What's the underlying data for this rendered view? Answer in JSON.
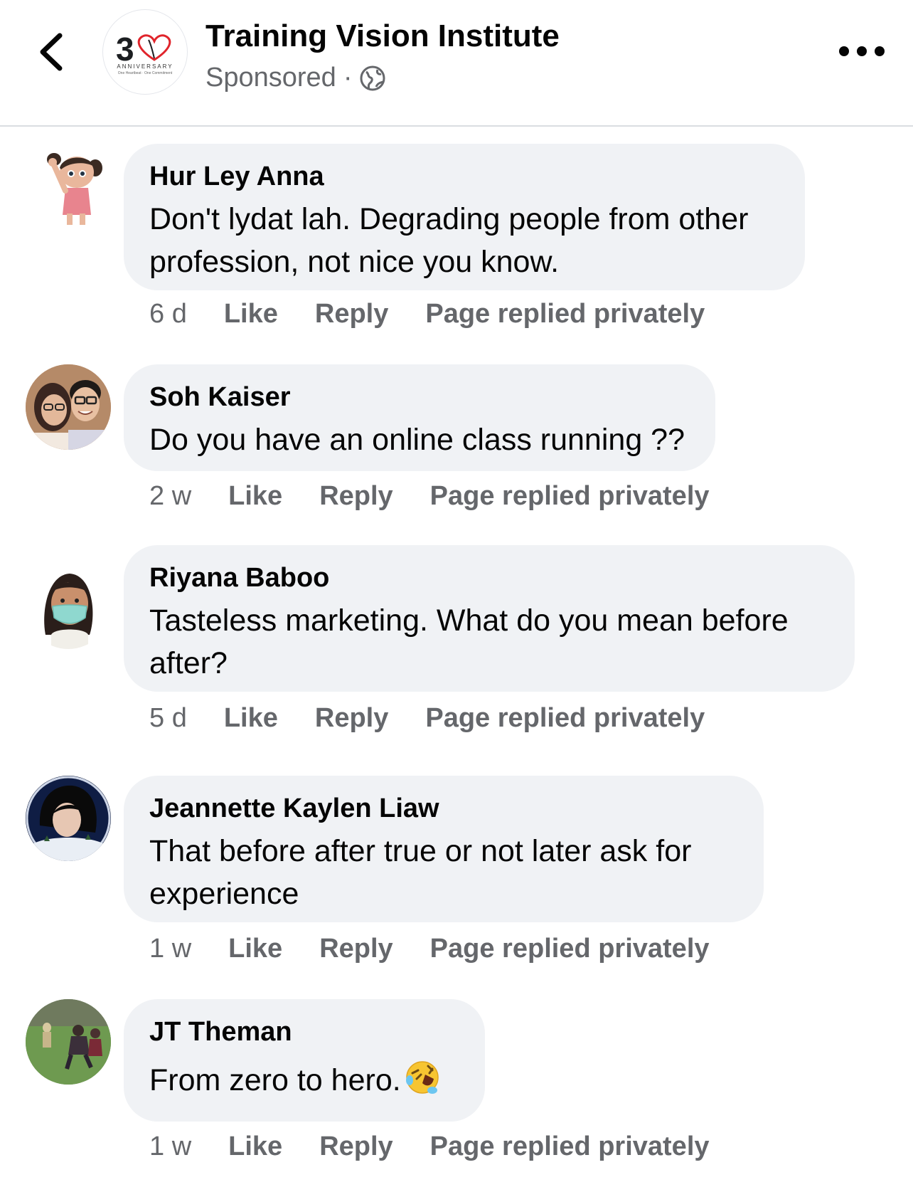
{
  "header": {
    "page_name": "Training Vision Institute",
    "sponsored": "Sponsored",
    "separator": "·",
    "logo_number": "3",
    "logo_tagline": "ANNIVERSARY",
    "logo_subtagline": "One Heartbeat · One Commitment",
    "back_icon": "chevron-left-icon",
    "more_icon": "more-horizontal-icon",
    "audience_icon": "globe-icon"
  },
  "comments": [
    {
      "author": "Hur Ley Anna",
      "text": "Don't lydat lah. Degrading people from other profession, not nice you know.",
      "time": "6 d",
      "like": "Like",
      "reply": "Reply",
      "status": "Page replied privately"
    },
    {
      "author": "Soh Kaiser",
      "text": "Do you have an online class running ??",
      "time": "2 w",
      "like": "Like",
      "reply": "Reply",
      "status": "Page replied privately"
    },
    {
      "author": "Riyana Baboo",
      "text": "Tasteless marketing. What do you mean before after?",
      "time": "5 d",
      "like": "Like",
      "reply": "Reply",
      "status": "Page replied privately"
    },
    {
      "author": "Jeannette Kaylen Liaw",
      "text": "That before after true or not later ask for experience",
      "time": "1 w",
      "like": "Like",
      "reply": "Reply",
      "status": "Page replied privately"
    },
    {
      "author": "JT Theman",
      "text": "From zero to hero.",
      "emoji": "rolling-on-floor-laughing-emoji",
      "time": "1 w",
      "like": "Like",
      "reply": "Reply",
      "status": "Page replied privately"
    }
  ],
  "colors": {
    "bubble": "#f0f2f5",
    "meta_text": "#65676b",
    "primary_text": "#050505",
    "logo_heart": "#e0242b"
  }
}
